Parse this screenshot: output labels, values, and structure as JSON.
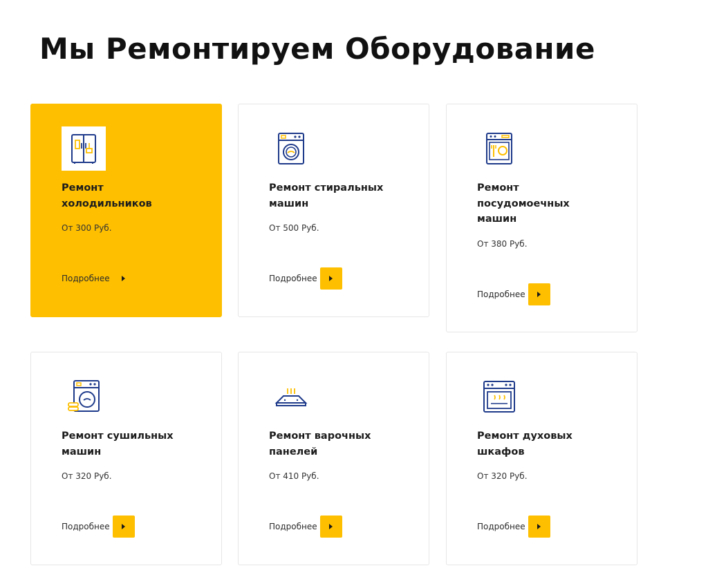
{
  "page": {
    "title": "Мы Ремонтируем Оборудование"
  },
  "cards": [
    {
      "title_line1": "Ремонт",
      "title_line2": "холодильников",
      "title_line3": "",
      "price": "От 300 Руб.",
      "more": "Подробнее",
      "icon": "refrigerator-icon",
      "active": true
    },
    {
      "title_line1": "Ремонт стиральных",
      "title_line2": "машин",
      "title_line3": "",
      "price": "От 500 Руб.",
      "more": "Подробнее",
      "icon": "washing-machine-icon",
      "active": false
    },
    {
      "title_line1": "Ремонт",
      "title_line2": "посудомоечных",
      "title_line3": "машин",
      "price": "От 380 Руб.",
      "more": "Подробнее",
      "icon": "dishwasher-icon",
      "active": false
    },
    {
      "title_line1": "Ремонт сушильных",
      "title_line2": "машин",
      "title_line3": "",
      "price": "От 320 Руб.",
      "more": "Подробнее",
      "icon": "dryer-icon",
      "active": false
    },
    {
      "title_line1": "Ремонт варочных",
      "title_line2": "панелей",
      "title_line3": "",
      "price": "От 410 Руб.",
      "more": "Подробнее",
      "icon": "cooktop-icon",
      "active": false
    },
    {
      "title_line1": "Ремонт духовых",
      "title_line2": "шкафов",
      "title_line3": "",
      "price": "От 320 Руб.",
      "more": "Подробнее",
      "icon": "oven-icon",
      "active": false
    }
  ],
  "colors": {
    "accent": "#fdbf00",
    "icon_blue": "#1e3a8a"
  }
}
